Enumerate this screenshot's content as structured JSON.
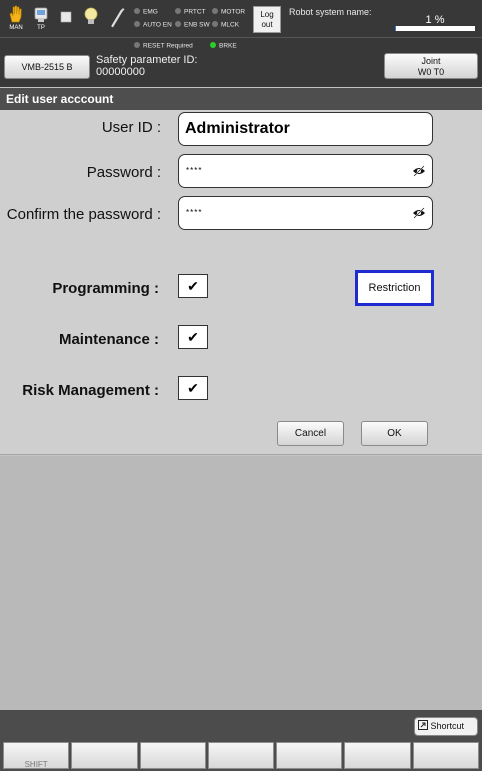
{
  "topbar": {
    "icons": [
      {
        "name": "hand-icon",
        "caption": "MAN"
      },
      {
        "name": "teach-pendant-icon",
        "caption": "TP"
      },
      {
        "name": "stop-icon",
        "caption": ""
      },
      {
        "name": "lightbulb-icon",
        "caption": ""
      },
      {
        "name": "wrench-icon",
        "caption": ""
      }
    ],
    "indicators": [
      {
        "label": "EMG",
        "color": "#777777"
      },
      {
        "label": "PRTCT",
        "color": "#777777"
      },
      {
        "label": "MOTOR",
        "color": "#777777"
      },
      {
        "label": "AUTO EN",
        "color": "#777777"
      },
      {
        "label": "ENB SW",
        "color": "#777777"
      },
      {
        "label": "MLCK",
        "color": "#777777"
      },
      {
        "label": "RESET Required",
        "color": "#777777"
      },
      {
        "label": "BRKE",
        "color": "#27d027"
      }
    ],
    "logout_line1": "Log",
    "logout_line2": "out",
    "robot_system_name_label": "Robot system name:",
    "speed_text": "1 %",
    "speed_fraction": 0.01
  },
  "bar2": {
    "model_button": "VMB-2515 B",
    "safety_label": "Safety parameter ID:",
    "safety_value": "00000000",
    "joint_line1": "Joint",
    "joint_line2": "W0 T0"
  },
  "dialog": {
    "title": "Edit user acccount",
    "user_id_label": "User ID :",
    "user_id_value": "Administrator",
    "password_label": "Password :",
    "password_mask": "****",
    "confirm_label": "Confirm the password :",
    "confirm_mask": "****",
    "permissions": [
      {
        "label": "Programming :",
        "checked": true
      },
      {
        "label": "Maintenance :",
        "checked": true
      },
      {
        "label": "Risk Management :",
        "checked": true
      }
    ],
    "check_mark": "✔",
    "restriction_button": "Restriction",
    "cancel_button": "Cancel",
    "ok_button": "OK"
  },
  "bottom": {
    "shortcut_button": "Shortcut",
    "fkeys": [
      "SHIFT",
      "",
      "",
      "",
      "",
      "",
      ""
    ]
  },
  "colors": {
    "focus_border": "#1d2bcf",
    "brake_indicator": "#27d027",
    "speed_fill": "#3a7bd5"
  }
}
